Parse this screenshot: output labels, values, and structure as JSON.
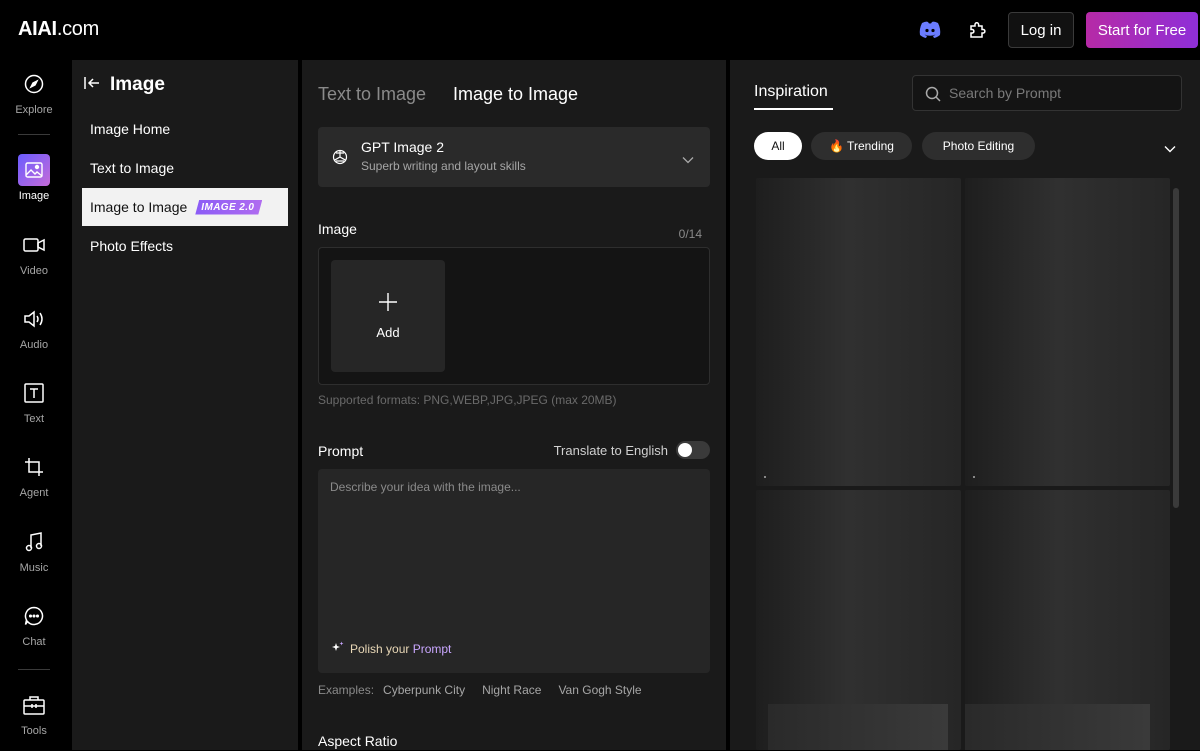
{
  "header": {
    "logo_bold": "AIAI",
    "logo_rest": ".com",
    "login_label": "Log in",
    "cta_label": "Start for Free",
    "icons": [
      "discord-icon",
      "extension-icon"
    ]
  },
  "rail": {
    "items": [
      {
        "label": "Explore",
        "icon": "compass-icon"
      },
      {
        "label": "Image",
        "icon": "image-icon"
      },
      {
        "label": "Video",
        "icon": "video-icon"
      },
      {
        "label": "Audio",
        "icon": "speaker-icon"
      },
      {
        "label": "Text",
        "icon": "text-icon"
      },
      {
        "label": "Agent",
        "icon": "crop-icon"
      },
      {
        "label": "Music",
        "icon": "music-note-icon"
      },
      {
        "label": "Chat",
        "icon": "chat-icon"
      },
      {
        "label": "Tools",
        "icon": "toolbox-icon"
      }
    ],
    "active": "Image"
  },
  "subnav": {
    "title": "Image",
    "items": [
      {
        "label": "Image Home"
      },
      {
        "label": "Text to Image"
      },
      {
        "label": "Image to Image",
        "badge": "IMAGE 2.0"
      },
      {
        "label": "Photo Effects"
      }
    ],
    "active": "Image to Image"
  },
  "center": {
    "tabs": [
      "Text to Image",
      "Image to Image"
    ],
    "active_tab": "Image to Image",
    "model": {
      "name": "GPT Image 2",
      "desc": "Superb writing and layout skills"
    },
    "image_label": "Image",
    "image_counter": "0/14",
    "add_label": "Add",
    "formats": "Supported formats: PNG,WEBP,JPG,JPEG (max 20MB)",
    "prompt_label": "Prompt",
    "translate_label": "Translate to English",
    "translate_on": false,
    "prompt_placeholder": "Describe your idea with the image...",
    "polish_prefix": "Polish your ",
    "polish_accent": "Prompt",
    "examples_label": "Examples:",
    "examples": [
      "Cyberpunk City",
      "Night Race",
      "Van Gogh Style"
    ],
    "aspect_label": "Aspect Ratio"
  },
  "inspiration": {
    "tab": "Inspiration",
    "search_placeholder": "Search by Prompt",
    "chips": [
      {
        "label": "All"
      },
      {
        "label": "🔥 Trending"
      },
      {
        "label": "Photo Editing"
      }
    ],
    "active_chip": "All"
  },
  "colors": {
    "accent_gradient_start": "#b62aa6",
    "accent_gradient_end": "#8f2fd8",
    "badge": "#8b5cf6",
    "panel": "#1a1a1a",
    "background": "#000000"
  }
}
